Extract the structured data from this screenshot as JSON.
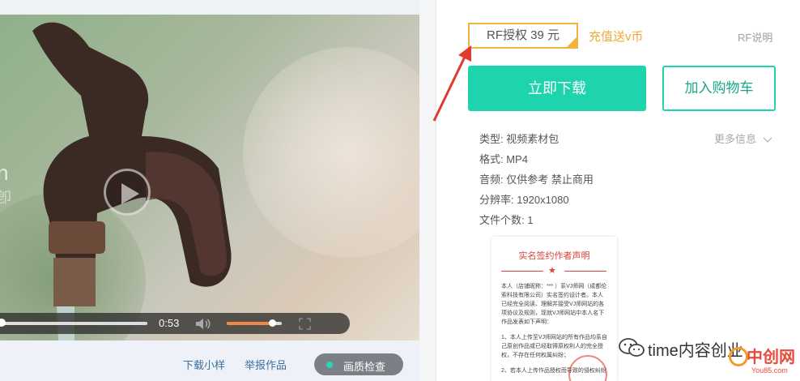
{
  "video": {
    "watermark_main": "n",
    "watermark_sub": "卽",
    "time": "0:53",
    "progress_fraction": 0.0,
    "volume_fraction": 0.82
  },
  "links": {
    "download_sample": "下载小样",
    "report_work": "举报作品",
    "quality_check": "画质检查"
  },
  "pricing": {
    "rf_badge": "RF授权 39 元",
    "recharge": "充值送v币",
    "rf_explain": "RF说明"
  },
  "actions": {
    "download_now": "立即下载",
    "add_to_cart": "加入购物车"
  },
  "meta": {
    "type": "类型: 视频素材包",
    "format": "格式: MP4",
    "audio": "音频: 仅供参考 禁止商用",
    "resolution": "分辨率: 1920x1080",
    "file_count": "文件个数: 1",
    "more_info": "更多信息"
  },
  "document": {
    "title": "实名签约作者声明",
    "body1": "本人（店铺昵称：*** ）系VJ师网（成都伦索科技有限公司）实名签约设计者。本人已经完全阅读、理解并接受VJ师网站的各项协议及规则，现就VJ师网站中本人名下作品发表如下声明：",
    "body2": "1、本人上传至VJ师网站的所有作品均系自己原创作品或已经取得原权利人的完全授权，不存在任何权属纠纷；",
    "body3": "2、若本人上传作品授权而导致的侵权纠纷"
  },
  "overlay": {
    "wechat_text": "time内容创业",
    "site_logo": "中创网",
    "site_url": "You85.com"
  },
  "colors": {
    "accent": "#1ed4ad",
    "badge_border": "#f0b43a",
    "recharge": "#f0a838",
    "arrow": "#e03a2f"
  }
}
